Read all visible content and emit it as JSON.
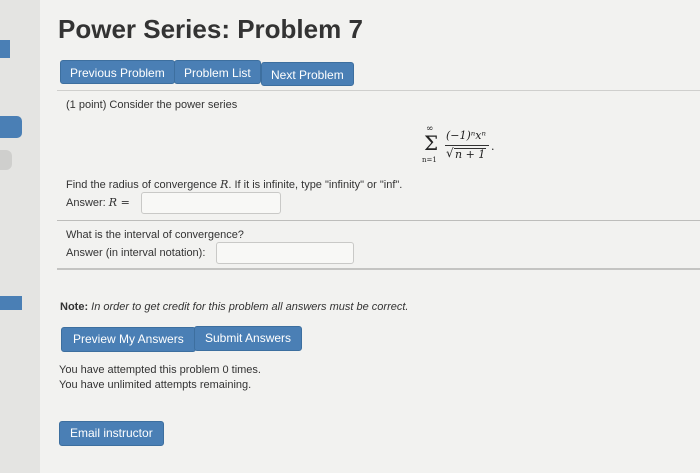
{
  "header": {
    "title": "Power Series: Problem 7"
  },
  "nav": {
    "previous": "Previous Problem",
    "list": "Problem List",
    "next": "Next Problem"
  },
  "problem": {
    "intro": "(1 point) Consider the power series",
    "series": {
      "sum_symbol": "Σ",
      "upper_limit": "∞",
      "lower_limit": "n=1",
      "numerator": "(−1)ⁿxⁿ",
      "denominator": "n + 1",
      "root_symbol": "√",
      "terminator": "."
    },
    "part1": {
      "question_a": "Find the radius of convergence ",
      "question_var": "R",
      "question_b": ". If it is infinite, type \"infinity\" or \"inf\".",
      "answer_label": "Answer: ",
      "answer_var": "R",
      "answer_eq": " ="
    },
    "part2": {
      "question": "What is the interval of convergence?",
      "answer_label": "Answer (in interval notation):"
    }
  },
  "note": {
    "label": "Note:",
    "text": " In order to get credit for this problem all answers must be correct."
  },
  "actions": {
    "preview": "Preview My Answers",
    "submit": "Submit Answers"
  },
  "attempts": {
    "line1": "You have attempted this problem 0 times.",
    "line2": "You have unlimited attempts remaining."
  },
  "footer": {
    "email": "Email instructor"
  },
  "colors": {
    "button": "#4a7fb5",
    "background": "#f2f2f0"
  }
}
